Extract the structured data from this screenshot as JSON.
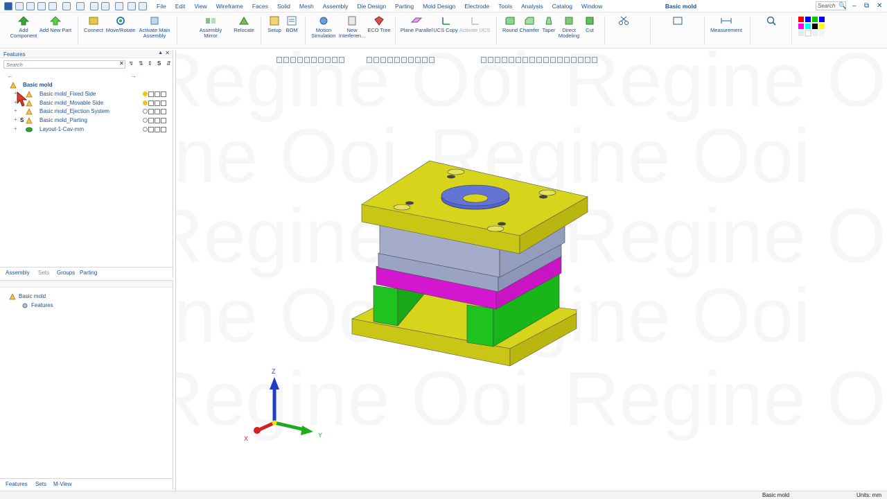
{
  "app": {
    "document_title": "Basic mold"
  },
  "menu": [
    "File",
    "Edit",
    "View",
    "Wireframe",
    "Faces",
    "Solid",
    "Mesh",
    "Assembly",
    "Die Design",
    "Parting",
    "Mold Design",
    "Electrode",
    "Tools",
    "Analysis",
    "Catalog",
    "Window"
  ],
  "search": {
    "placeholder": "Search"
  },
  "ribbon": {
    "add_component": "Add Component",
    "add_new_part": "Add New Part",
    "connect": "Connect",
    "move_rotate": "Move/Rotate",
    "activate_main_assembly": "Activate Main Assembly",
    "assembly_mirror": "Assembly Mirror",
    "relocate": "Relocate",
    "setup": "Setup",
    "bom": "BOM",
    "motion_simulation": "Motion Simulation",
    "new_interference": "New Interferen...",
    "eco_tree": "ECO Tree",
    "plane_parallel": "Plane Parallel",
    "ucs_copy": "UCS Copy",
    "activate_ucs": "Activate UCS",
    "round": "Round",
    "chamfer": "Chamfer",
    "taper": "Taper",
    "direct_modeling": "Direct Modeling",
    "cut": "Cut",
    "measurement": "Measurement"
  },
  "features_panel": {
    "title": "Features",
    "search_placeholder": "Search",
    "root": "Basic mold",
    "items": [
      {
        "label": "Basic mold_Fixed Side",
        "prefix": ""
      },
      {
        "label": "Basic mold_Movable Side",
        "prefix": ""
      },
      {
        "label": "Basic mold_Ejection System",
        "prefix": ""
      },
      {
        "label": "Basic mold_Parting",
        "prefix": "S"
      },
      {
        "label": "Layout-1-Cav-mm",
        "prefix": ""
      }
    ]
  },
  "tabs_top": [
    "Assembly",
    "Sets",
    "Groups",
    "Parting"
  ],
  "assembly_panel": {
    "root": "Basic mold",
    "child": "Features"
  },
  "tabs_bottom": [
    "Features",
    "Sets",
    "M-View"
  ],
  "watermark": "Regine Ooi",
  "axes": {
    "x": "X",
    "y": "Y",
    "z": "Z"
  },
  "status": {
    "document": "Basic mold",
    "units": "Units: mm"
  },
  "colors": {
    "plate_yellow": "#d7d51b",
    "plate_gray": "#9aa3c4",
    "plate_magenta": "#d417cf",
    "block_green": "#1fc21f",
    "ring_blue": "#5566c8",
    "accent_text": "#1c4f97"
  }
}
